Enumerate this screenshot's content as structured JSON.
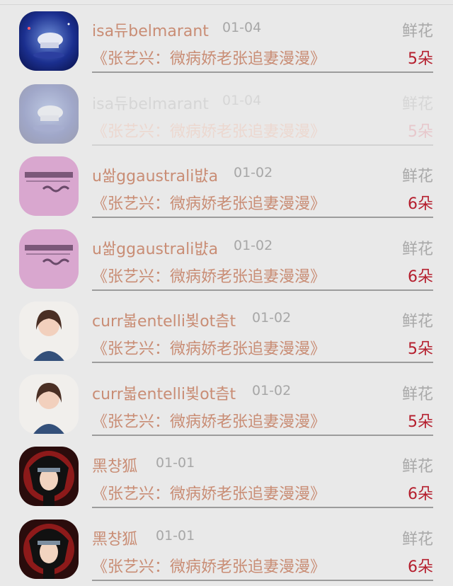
{
  "rows": [
    {
      "name": "isa듀belmarant",
      "date": "01-04",
      "gift": "鲜花",
      "title": "《张艺兴：微病娇老张追妻漫漫》",
      "count": "5朵",
      "avatar": "night-sky-avatar"
    },
    {
      "name": "isa듀belmarant",
      "date": "01-04",
      "gift": "鲜花",
      "title": "《张艺兴：微病娇老张追妻漫漫》",
      "count": "5朵",
      "avatar": "night-sky-avatar"
    },
    {
      "name": "u쌂ggaustrali뱞a",
      "date": "01-02",
      "gift": "鲜花",
      "title": "《张艺兴：微病娇老张追妻漫漫》",
      "count": "6朵",
      "avatar": "pink-text-avatar"
    },
    {
      "name": "u쌂ggaustrali뱞a",
      "date": "01-02",
      "gift": "鲜花",
      "title": "《张艺兴：微病娇老张追妻漫漫》",
      "count": "6朵",
      "avatar": "pink-text-avatar"
    },
    {
      "name": "curr볿entelli뵟ot츰t",
      "date": "01-02",
      "gift": "鲜花",
      "title": "《张艺兴：微病娇老张追妻漫漫》",
      "count": "5朵",
      "avatar": "girl-portrait-avatar"
    },
    {
      "name": "curr볿entelli뵟ot츰t",
      "date": "01-02",
      "gift": "鲜花",
      "title": "《张艺兴：微病娇老张追妻漫漫》",
      "count": "5朵",
      "avatar": "girl-portrait-avatar"
    },
    {
      "name": "黑챵狐",
      "date": "01-01",
      "gift": "鲜花",
      "title": "《张艺兴：微病娇老张追妻漫漫》",
      "count": "6朵",
      "avatar": "anime-ninja-avatar"
    },
    {
      "name": "黑챵狐",
      "date": "01-01",
      "gift": "鲜花",
      "title": "《张艺兴：微病娇老张追妻漫漫》",
      "count": "6朵",
      "avatar": "anime-ninja-avatar"
    }
  ],
  "colors": {
    "background": "#e9e9e9",
    "name_text": "#c98d75",
    "date_text": "#a7a7a7",
    "count_text": "#b51f2e",
    "divider": "#9c9c9c"
  }
}
